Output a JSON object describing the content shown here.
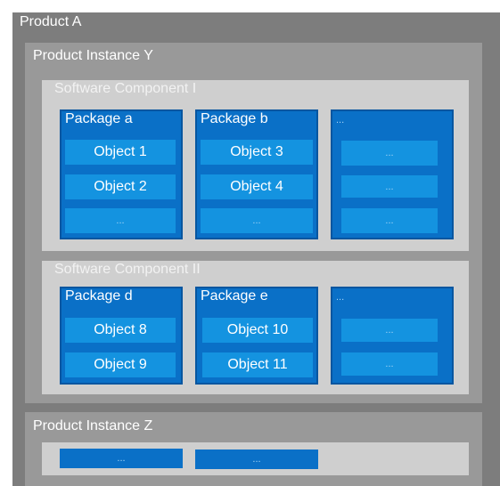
{
  "product": {
    "title": "Product  A"
  },
  "instance_y": {
    "title": "Product Instance Y",
    "component_1": {
      "title": "Software Component I",
      "packages": [
        {
          "title": "Package a",
          "objects": [
            "Object 1",
            "Object 2",
            "..."
          ]
        },
        {
          "title": "Package b",
          "objects": [
            "Object 3",
            "Object 4",
            "..."
          ]
        },
        {
          "title": "...",
          "objects": [
            "...",
            "...",
            "..."
          ]
        }
      ]
    },
    "component_2": {
      "title": "Software Component II",
      "packages": [
        {
          "title": "Package d",
          "objects": [
            "Object 8",
            "Object 9"
          ]
        },
        {
          "title": "Package e",
          "objects": [
            "Object 10",
            "Object 11"
          ]
        },
        {
          "title": "...",
          "objects": [
            "...",
            "..."
          ]
        }
      ]
    }
  },
  "instance_z": {
    "title": "Product Instance Z",
    "items": [
      "...",
      "..."
    ]
  }
}
